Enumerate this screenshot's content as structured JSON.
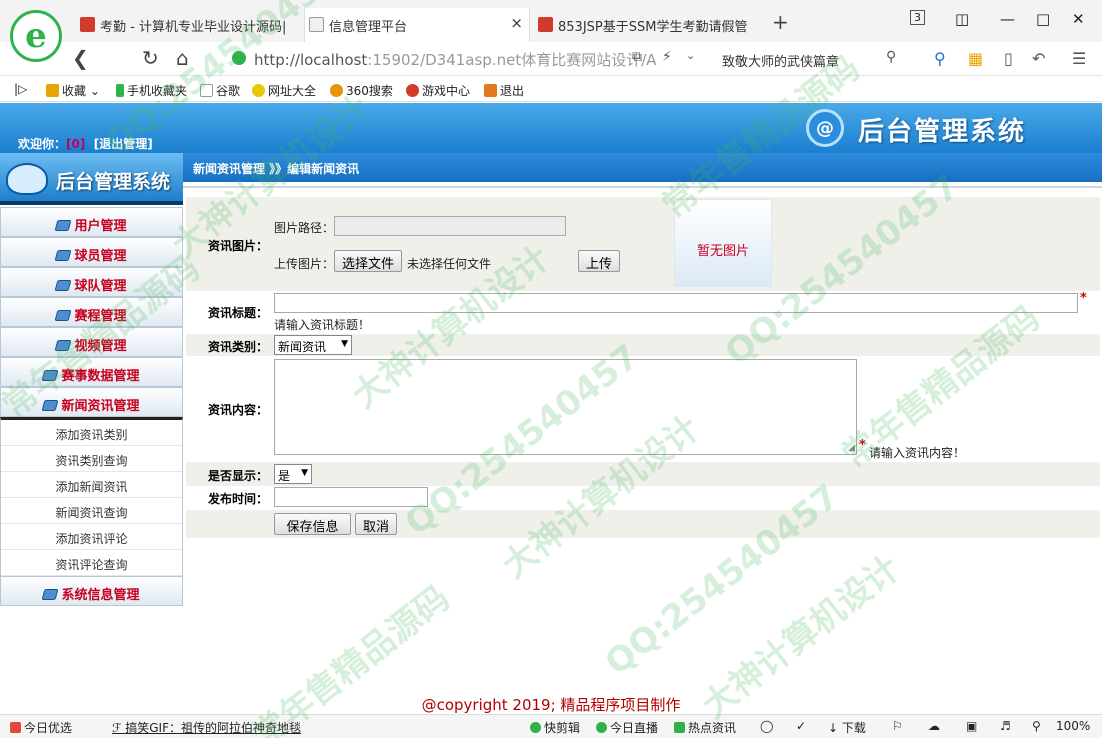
{
  "browser": {
    "tabs": [
      {
        "label": "考勤 - 计算机专业毕业设计源码|",
        "fav_color": "#d13b2c"
      },
      {
        "label": "信息管理平台",
        "fav_color": "#f0f0f0"
      },
      {
        "label": "853JSP基于SSM学生考勤请假管",
        "fav_color": "#d13b2c"
      }
    ],
    "tab_close": "×",
    "new_tab": "+",
    "tab_count": "3",
    "url_host": "http://localhost",
    "url_path": ":15902/D341asp.net体育比赛网站设计/A",
    "search_text": "致敬大师的武侠篇章",
    "bookmarks": [
      {
        "label": "收藏",
        "color": "#e8a400"
      },
      {
        "label": "手机收藏夹",
        "color": "#2fb24a"
      },
      {
        "label": "谷歌",
        "color": "#cccccc"
      },
      {
        "label": "网址大全",
        "color": "#e8c800"
      },
      {
        "label": "360搜索",
        "color": "#e89400"
      },
      {
        "label": "游戏中心",
        "color": "#d13b2c"
      },
      {
        "label": "退出",
        "color": "#e07a1a"
      }
    ]
  },
  "header": {
    "welcome_label": "欢迎你：",
    "username": "[0]",
    "logout_label": "[退出管理]",
    "system_title": "后台管理系统",
    "sidebar_title": "后台管理系统"
  },
  "menu": {
    "items_top": [
      "用户管理",
      "球员管理",
      "球队管理",
      "赛程管理",
      "视频管理",
      "赛事数据管理",
      "新闻资讯管理"
    ],
    "subitems": [
      "添加资讯类别",
      "资讯类别查询",
      "添加新闻资讯",
      "新闻资讯查询",
      "添加资讯评论",
      "资讯评论查询"
    ],
    "item_bottom": "系统信息管理"
  },
  "breadcrumb": "新闻资讯管理 》》编辑新闻资讯",
  "form": {
    "image_label": "资讯图片：",
    "image_path_label": "图片路径：",
    "upload_label": "上传图片：",
    "choose_file_button": "选择文件",
    "no_file_text": "未选择任何文件",
    "upload_button": "上传",
    "no_image_text": "暂无图片",
    "title_label": "资讯标题：",
    "title_hint": "请输入资讯标题！",
    "category_label": "资讯类别：",
    "category_value": "新闻资讯",
    "content_label": "资讯内容：",
    "content_hint": "请输入资讯内容！",
    "display_label": "是否显示：",
    "display_value": "是",
    "publish_time_label": "发布时间：",
    "save_button": "保存信息",
    "cancel_button": "取消",
    "required_mark": "*"
  },
  "footer": {
    "copyright": "@copyright 2019; 精品程序项目制作"
  },
  "statusbar": {
    "today_pick": "今日优选",
    "news_link": "搞笑GIF：祖传的阿拉伯神奇地毯",
    "clip": "快剪辑",
    "live": "今日直播",
    "hot": "热点资讯",
    "download": "下载",
    "zoom": "100%"
  },
  "watermark": [
    "QQ:254540457",
    "常年售精品源码",
    "大神计算机设计",
    "QQ:254540457",
    "常年售精品源码",
    "大神计算机设计",
    "QQ:254540457",
    "常年售精品源码",
    "大神计算机设计",
    "QQ:254540457",
    "常年售精品源码",
    "大神计算机设计"
  ]
}
